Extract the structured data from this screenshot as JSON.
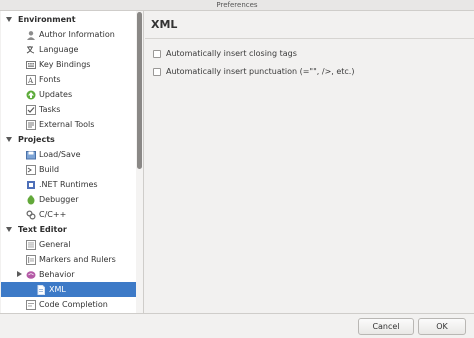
{
  "window": {
    "title": "Preferences"
  },
  "sidebar": {
    "categories": [
      {
        "label": "Environment",
        "items": [
          {
            "label": "Author Information",
            "icon": "author-icon"
          },
          {
            "label": "Language",
            "icon": "language-icon"
          },
          {
            "label": "Key Bindings",
            "icon": "keyboard-icon"
          },
          {
            "label": "Fonts",
            "icon": "fonts-icon"
          },
          {
            "label": "Updates",
            "icon": "updates-icon"
          },
          {
            "label": "Tasks",
            "icon": "tasks-icon"
          },
          {
            "label": "External Tools",
            "icon": "external-tools-icon"
          }
        ]
      },
      {
        "label": "Projects",
        "items": [
          {
            "label": "Load/Save",
            "icon": "load-save-icon"
          },
          {
            "label": "Build",
            "icon": "build-icon"
          },
          {
            "label": ".NET Runtimes",
            "icon": "runtimes-icon"
          },
          {
            "label": "Debugger",
            "icon": "debugger-icon"
          },
          {
            "label": "C/C++",
            "icon": "cpp-icon"
          }
        ]
      },
      {
        "label": "Text Editor",
        "items": [
          {
            "label": "General",
            "icon": "general-icon"
          },
          {
            "label": "Markers and Rulers",
            "icon": "markers-icon"
          },
          {
            "label": "Behavior",
            "icon": "behavior-icon"
          },
          {
            "label": "XML",
            "icon": "xml-file-icon",
            "selected": true
          },
          {
            "label": "Code Completion",
            "icon": "code-completion-icon"
          }
        ]
      }
    ]
  },
  "panel": {
    "title": "XML",
    "options": [
      {
        "label": "Automatically insert closing tags",
        "checked": false
      },
      {
        "label": "Automatically insert punctuation (=\"\", />, etc.)",
        "checked": false
      }
    ]
  },
  "buttons": {
    "cancel": "Cancel",
    "ok": "OK"
  },
  "colors": {
    "selection": "#3d7ac7",
    "window_bg": "#f2f1f0"
  }
}
